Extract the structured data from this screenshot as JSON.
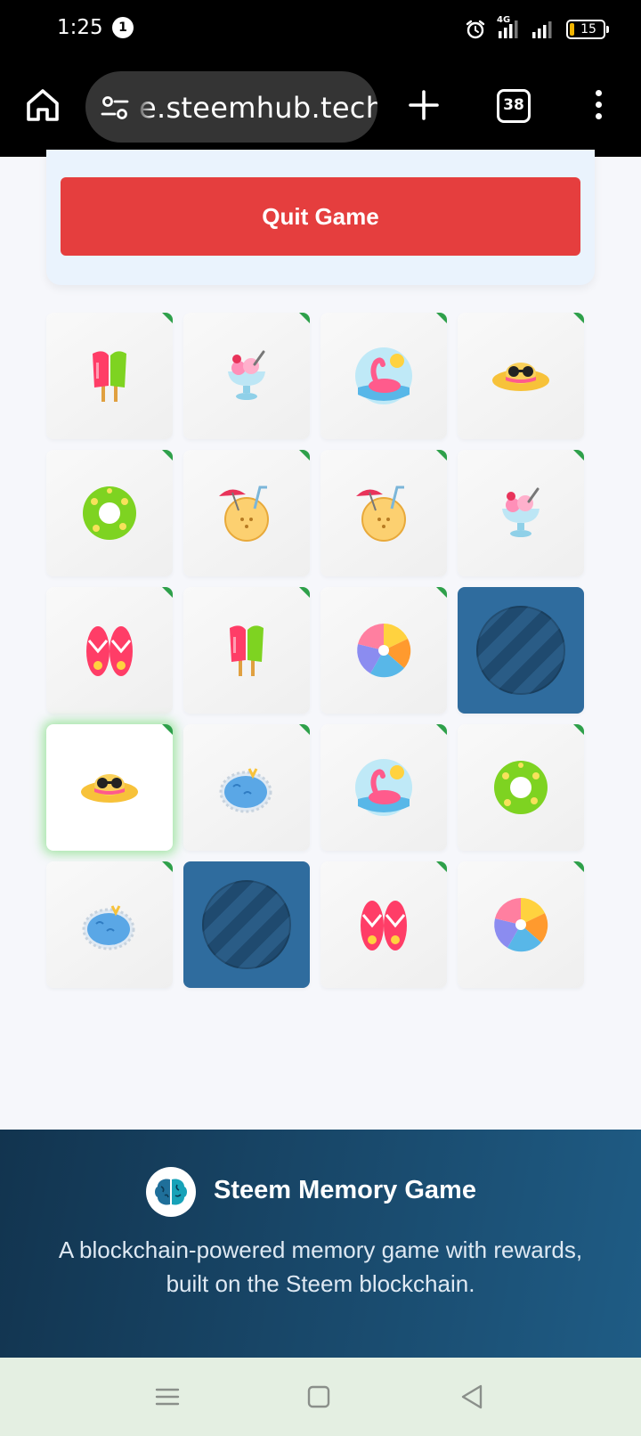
{
  "status_bar": {
    "time": "1:25",
    "notification_count": "1",
    "network_label": "4G",
    "battery_level": "15",
    "battery_fraction": 0.15
  },
  "browser": {
    "url": "e.steemhub.tech",
    "tab_count": "38"
  },
  "game": {
    "quit_label": "Quit Game",
    "cards": [
      {
        "icon": "popsicle-icon",
        "state": "matched"
      },
      {
        "icon": "ice-cream-cup-icon",
        "state": "matched"
      },
      {
        "icon": "flamingo-float-icon",
        "state": "matched"
      },
      {
        "icon": "sun-hat-icon",
        "state": "matched"
      },
      {
        "icon": "swim-ring-icon",
        "state": "matched"
      },
      {
        "icon": "coconut-drink-icon",
        "state": "matched"
      },
      {
        "icon": "coconut-drink-icon",
        "state": "matched"
      },
      {
        "icon": "ice-cream-cup-icon",
        "state": "matched"
      },
      {
        "icon": "flip-flops-icon",
        "state": "matched"
      },
      {
        "icon": "popsicle-icon",
        "state": "matched"
      },
      {
        "icon": "beach-ball-icon",
        "state": "matched"
      },
      {
        "icon": "card-back-icon",
        "state": "hidden"
      },
      {
        "icon": "sun-hat-icon",
        "state": "selected"
      },
      {
        "icon": "pool-icon",
        "state": "matched"
      },
      {
        "icon": "flamingo-float-icon",
        "state": "matched"
      },
      {
        "icon": "swim-ring-icon",
        "state": "matched"
      },
      {
        "icon": "pool-icon",
        "state": "matched"
      },
      {
        "icon": "card-back-icon",
        "state": "hidden"
      },
      {
        "icon": "flip-flops-icon",
        "state": "matched"
      },
      {
        "icon": "beach-ball-icon",
        "state": "matched"
      }
    ]
  },
  "footer": {
    "title": "Steem Memory Game",
    "description": "A blockchain-powered memory game with rewards, built on the Steem blockchain."
  },
  "colors": {
    "quit_button": "#e53e3e",
    "hidden_card": "#2f6c9e",
    "matched_tick": "#2ea04a",
    "footer_start": "#12344f",
    "footer_end": "#1f5c85"
  }
}
